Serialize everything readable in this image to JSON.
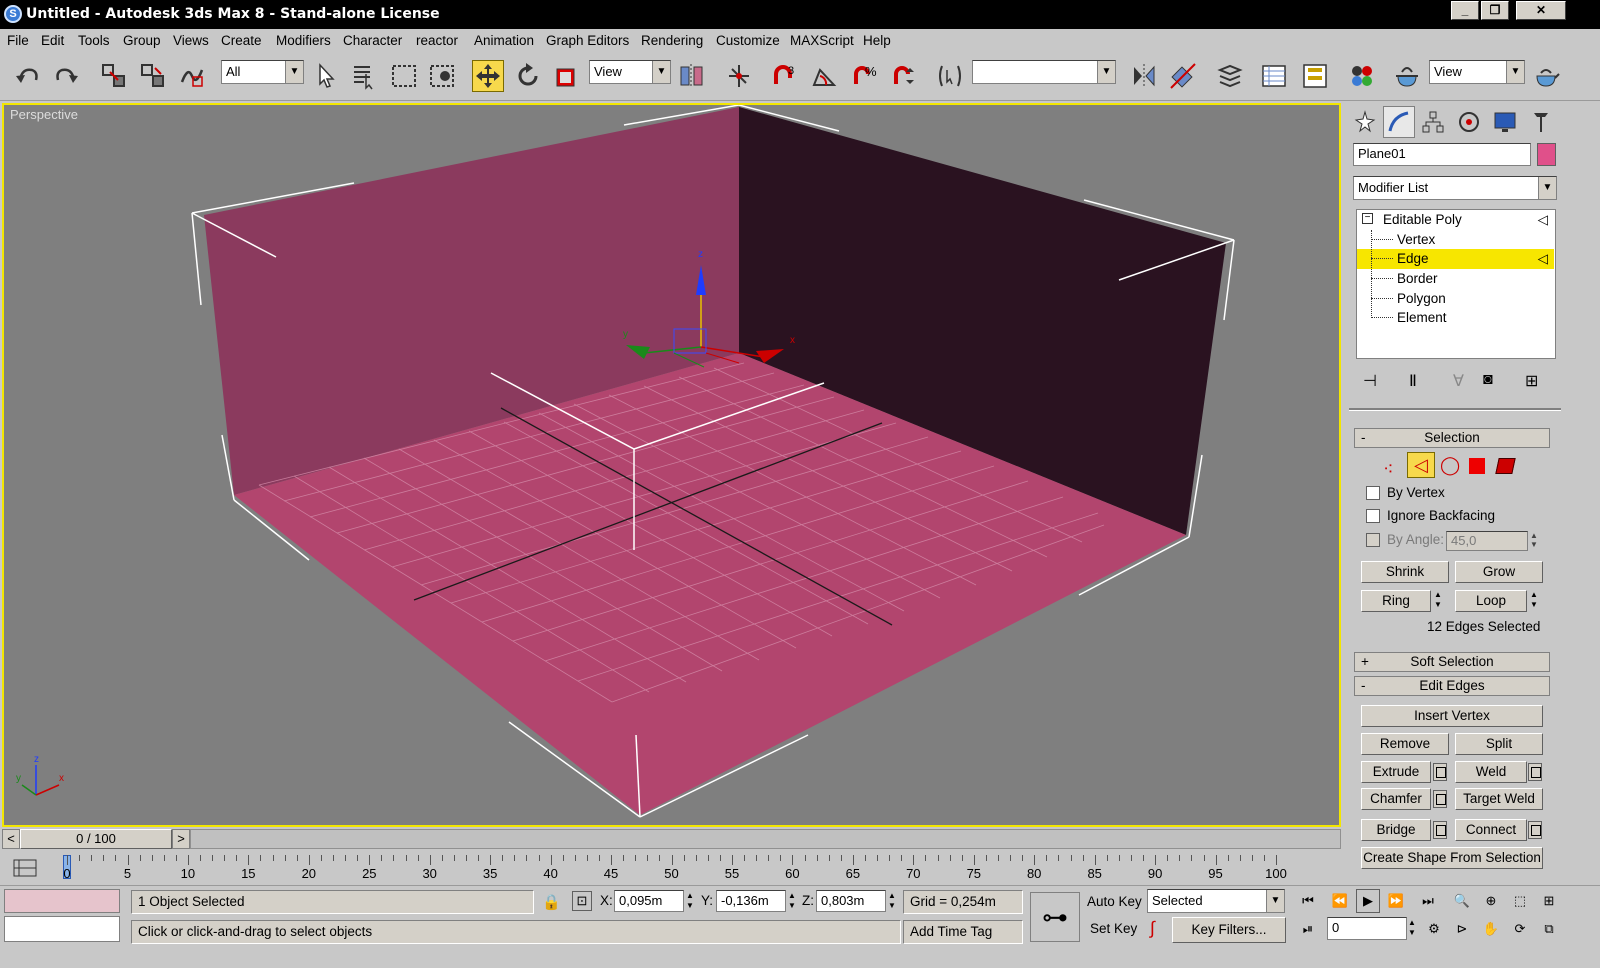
{
  "window": {
    "title": "Untitled - Autodesk 3ds Max 8  - Stand-alone License",
    "logo": "S",
    "controls": [
      "minimize-icon",
      "maximize-icon",
      "close-icon"
    ]
  },
  "menu": [
    "File",
    "Edit",
    "Tools",
    "Group",
    "Views",
    "Create",
    "Modifiers",
    "Character",
    "reactor",
    "Animation",
    "Graph Editors",
    "Rendering",
    "Customize",
    "MAXScript",
    "Help"
  ],
  "toolbar": {
    "selection_filter": "All",
    "coord_system": "View",
    "named_selection": "",
    "render_type": "View",
    "snap_angle_label": "3",
    "active_tool": "select-and-move"
  },
  "viewport": {
    "label": "Perspective",
    "object_color": "#b2456e",
    "background": "#7f7f7f",
    "gizmo_axes": [
      "x",
      "y",
      "z"
    ]
  },
  "command_panel": {
    "object_name": "Plane01",
    "object_color": "#e0508a",
    "modifier_list": "Modifier List",
    "stack": [
      {
        "label": "Editable Poly",
        "level": 0,
        "selected": false
      },
      {
        "label": "Vertex",
        "level": 1,
        "selected": false
      },
      {
        "label": "Edge",
        "level": 1,
        "selected": true
      },
      {
        "label": "Border",
        "level": 1,
        "selected": false
      },
      {
        "label": "Polygon",
        "level": 1,
        "selected": false
      },
      {
        "label": "Element",
        "level": 1,
        "selected": false
      }
    ],
    "selection": {
      "header": "Selection",
      "toggle": "-",
      "by_vertex": "By Vertex",
      "ignore_backfacing": "Ignore Backfacing",
      "by_angle": "By Angle:",
      "angle_value": "45,0",
      "shrink": "Shrink",
      "grow": "Grow",
      "ring": "Ring",
      "loop": "Loop",
      "status": "12 Edges Selected"
    },
    "soft_selection": {
      "header": "Soft Selection",
      "toggle": "+"
    },
    "edit_edges": {
      "header": "Edit Edges",
      "toggle": "-",
      "insert_vertex": "Insert Vertex",
      "remove": "Remove",
      "split": "Split",
      "extrude": "Extrude",
      "weld": "Weld",
      "chamfer": "Chamfer",
      "target_weld": "Target Weld",
      "bridge": "Bridge",
      "connect": "Connect",
      "create_shape": "Create Shape From Selection"
    }
  },
  "timeline": {
    "slider_label": "0 / 100",
    "prev": "<",
    "next": ">",
    "ticks": [
      "0",
      "5",
      "10",
      "15",
      "20",
      "25",
      "30",
      "35",
      "40",
      "45",
      "50",
      "55",
      "60",
      "65",
      "70",
      "75",
      "80",
      "85",
      "90",
      "95",
      "100"
    ]
  },
  "status": {
    "selection_info": "1 Object Selected",
    "prompt": "Click or click-and-drag to select objects",
    "x_label": "X:",
    "x": "0,095m",
    "y_label": "Y:",
    "y": "-0,136m",
    "z_label": "Z:",
    "z": "0,803m",
    "grid": "Grid = 0,254m",
    "add_time_tag": "Add Time Tag",
    "auto_key": "Auto Key",
    "set_key": "Set Key",
    "key_mode": "Selected",
    "key_filters": "Key Filters...",
    "current_frame": "0"
  }
}
